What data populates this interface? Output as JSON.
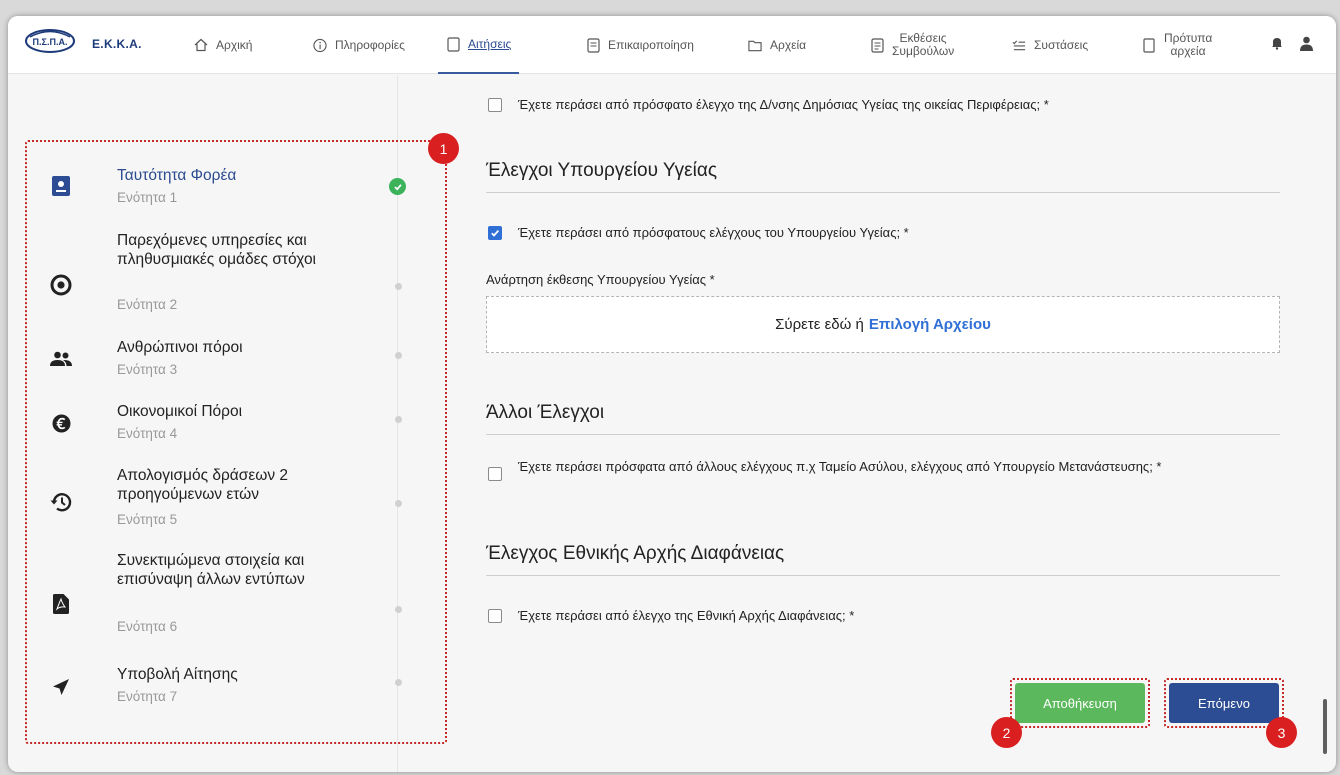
{
  "header": {
    "org_name": "Ε.Κ.Κ.Α.",
    "logo_text": "Π.Σ.Π.Α.",
    "nav": [
      {
        "label": "Αρχική",
        "icon": "home-icon"
      },
      {
        "label": "Πληροφορίες",
        "icon": "info-icon"
      },
      {
        "label": "Αιτήσεις",
        "icon": "document-icon",
        "active": true
      },
      {
        "label": "Επικαιροποίηση",
        "icon": "form-icon"
      },
      {
        "label": "Αρχεία",
        "icon": "folder-icon"
      },
      {
        "label": "Εκθέσεις Συμβούλων",
        "icon": "report-icon"
      },
      {
        "label": "Συστάσεις",
        "icon": "checklist-icon"
      },
      {
        "label": "Πρότυπα αρχεία",
        "icon": "template-icon"
      }
    ],
    "icons": [
      "bell-icon",
      "user-icon"
    ]
  },
  "sidebar": {
    "steps": [
      {
        "title": "Ταυτότητα Φορέα",
        "subtitle": "Ενότητα 1",
        "icon": "id-badge-icon",
        "status": "complete"
      },
      {
        "title": "Παρεχόμενες υπηρεσίες και πληθυσμιακές ομάδες στόχοι",
        "subtitle": "Ενότητα 2",
        "icon": "target-icon",
        "status": "pending"
      },
      {
        "title": "Ανθρώπινοι πόροι",
        "subtitle": "Ενότητα 3",
        "icon": "people-icon",
        "status": "pending"
      },
      {
        "title": "Οικονομικοί Πόροι",
        "subtitle": "Ενότητα 4",
        "icon": "euro-icon",
        "status": "pending"
      },
      {
        "title": "Απολογισμός δράσεων 2 προηγούμενων ετών",
        "subtitle": "Ενότητα 5",
        "icon": "history-icon",
        "status": "pending"
      },
      {
        "title": "Συνεκτιμώμενα στοιχεία και επισύναψη άλλων εντύπων",
        "subtitle": "Ενότητα 6",
        "icon": "pdf-icon",
        "status": "pending"
      },
      {
        "title": "Υποβολή Αίτησης",
        "subtitle": "Ενότητα 7",
        "icon": "send-icon",
        "status": "pending"
      }
    ]
  },
  "form": {
    "q_regional_health": {
      "label": "Έχετε περάσει από πρόσφατο έλεγχο της Δ/νσης Δημόσιας Υγείας της οικείας Περιφέρειας; *",
      "checked": false
    },
    "section_ministry": "Έλεγχοι Υπουργείου Υγείας",
    "q_ministry": {
      "label": "Έχετε περάσει από πρόσφατους ελέγχους του Υπουργείου Υγείας; *",
      "checked": true
    },
    "upload_label": "Ανάρτηση έκθεσης Υπουργείου Υγείας *",
    "dropzone_text": "Σύρετε εδώ ή",
    "dropzone_link": "Επιλογή Αρχείου",
    "section_other": "Άλλοι Έλεγχοι",
    "q_other": {
      "label": "Έχετε περάσει πρόσφατα από άλλους ελέγχους π.χ Ταμείο Ασύλου, ελέγχους από Υπουργείο Μετανάστευσης; *",
      "checked": false
    },
    "section_transparency": "Έλεγχος Εθνικής Αρχής Διαφάνειας",
    "q_transparency": {
      "label": "Έχετε περάσει από έλεγχο της Εθνική Αρχής Διαφάνειας; *",
      "checked": false
    }
  },
  "actions": {
    "save_label": "Αποθήκευση",
    "next_label": "Επόμενο"
  },
  "annotations": {
    "badge_1": "1",
    "badge_2": "2",
    "badge_3": "3"
  },
  "colors": {
    "primary": "#2c4c94",
    "save": "#5cb85c",
    "annotation": "#d91f1f",
    "check": "#3cb35a"
  }
}
